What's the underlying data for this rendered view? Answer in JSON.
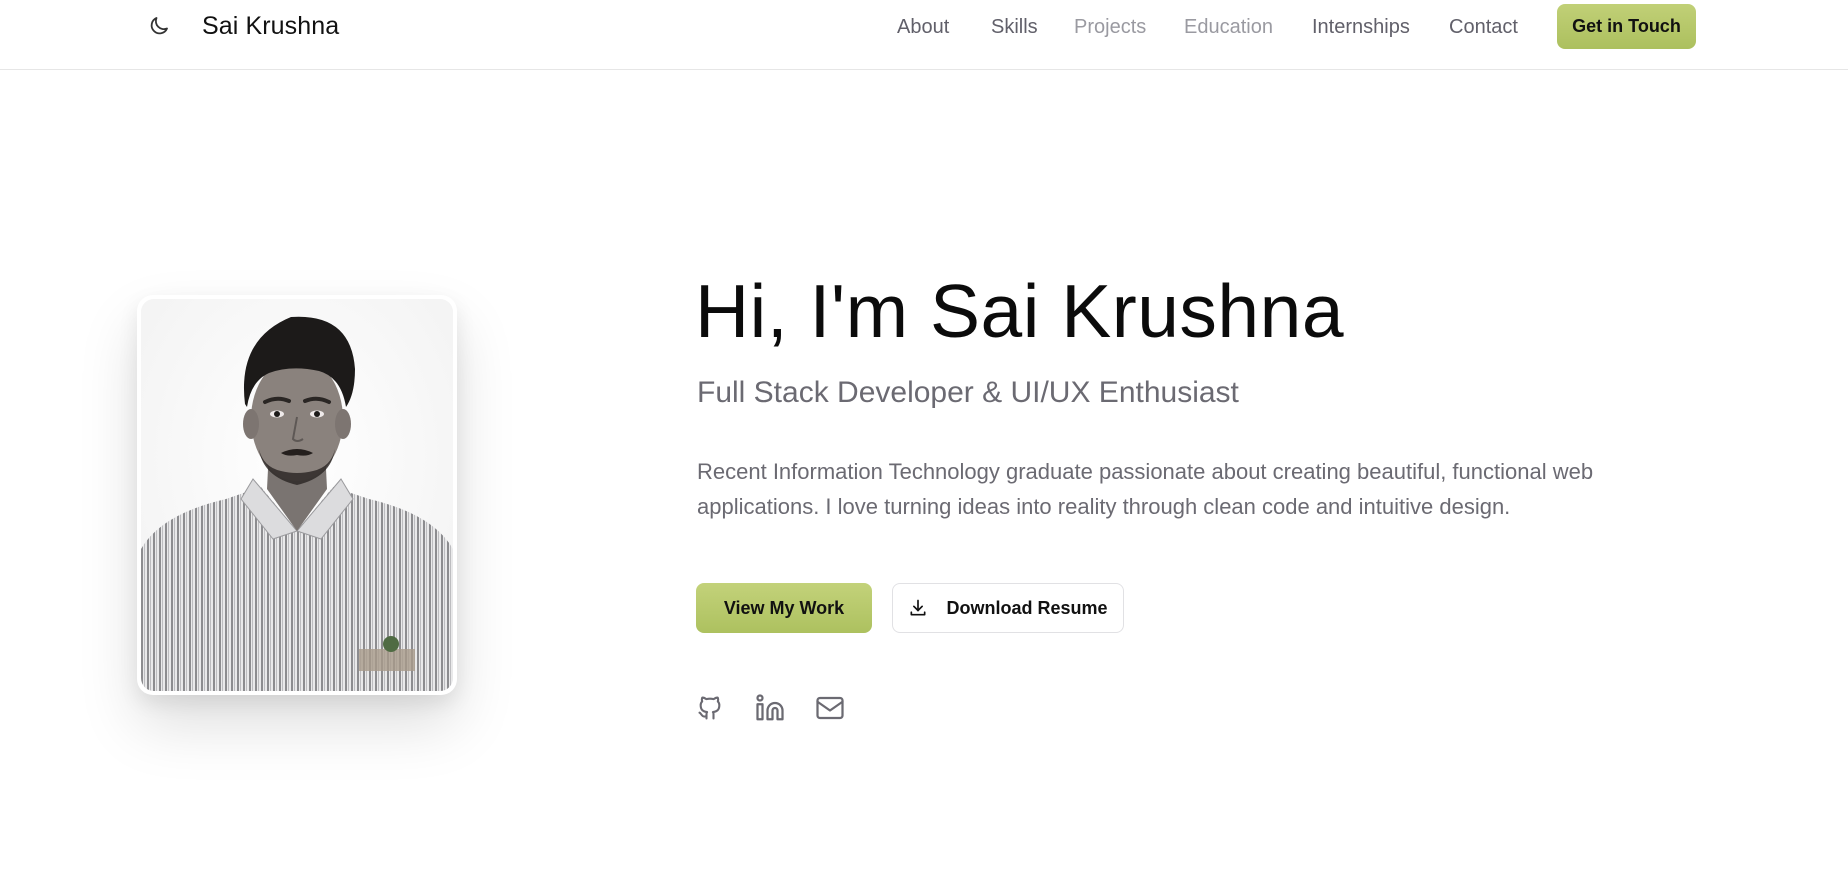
{
  "header": {
    "brand": "Sai Krushna",
    "theme_icon": "moon-icon",
    "nav": [
      {
        "label": "About",
        "state": "normal"
      },
      {
        "label": "Skills",
        "state": "normal"
      },
      {
        "label": "Projects",
        "state": "muted"
      },
      {
        "label": "Education",
        "state": "muted"
      },
      {
        "label": "Internships",
        "state": "normal"
      },
      {
        "label": "Contact",
        "state": "normal"
      }
    ],
    "cta_label": "Get in Touch"
  },
  "hero": {
    "title": "Hi, I'm Sai Krushna",
    "subtitle": "Full Stack Developer & UI/UX Enthusiast",
    "description": "Recent Information Technology graduate passionate about creating beautiful, functional web applications. I love turning ideas into reality through clean code and intuitive design.",
    "primary_button": "View My Work",
    "secondary_button": "Download Resume",
    "secondary_icon": "download-icon",
    "socials": [
      {
        "name": "github-icon"
      },
      {
        "name": "linkedin-icon"
      },
      {
        "name": "mail-icon"
      }
    ]
  },
  "colors": {
    "accent": "#b8c96b",
    "text_primary": "#0b0b0b",
    "text_muted": "#6b6a72",
    "nav_muted": "#9a9aa1"
  }
}
